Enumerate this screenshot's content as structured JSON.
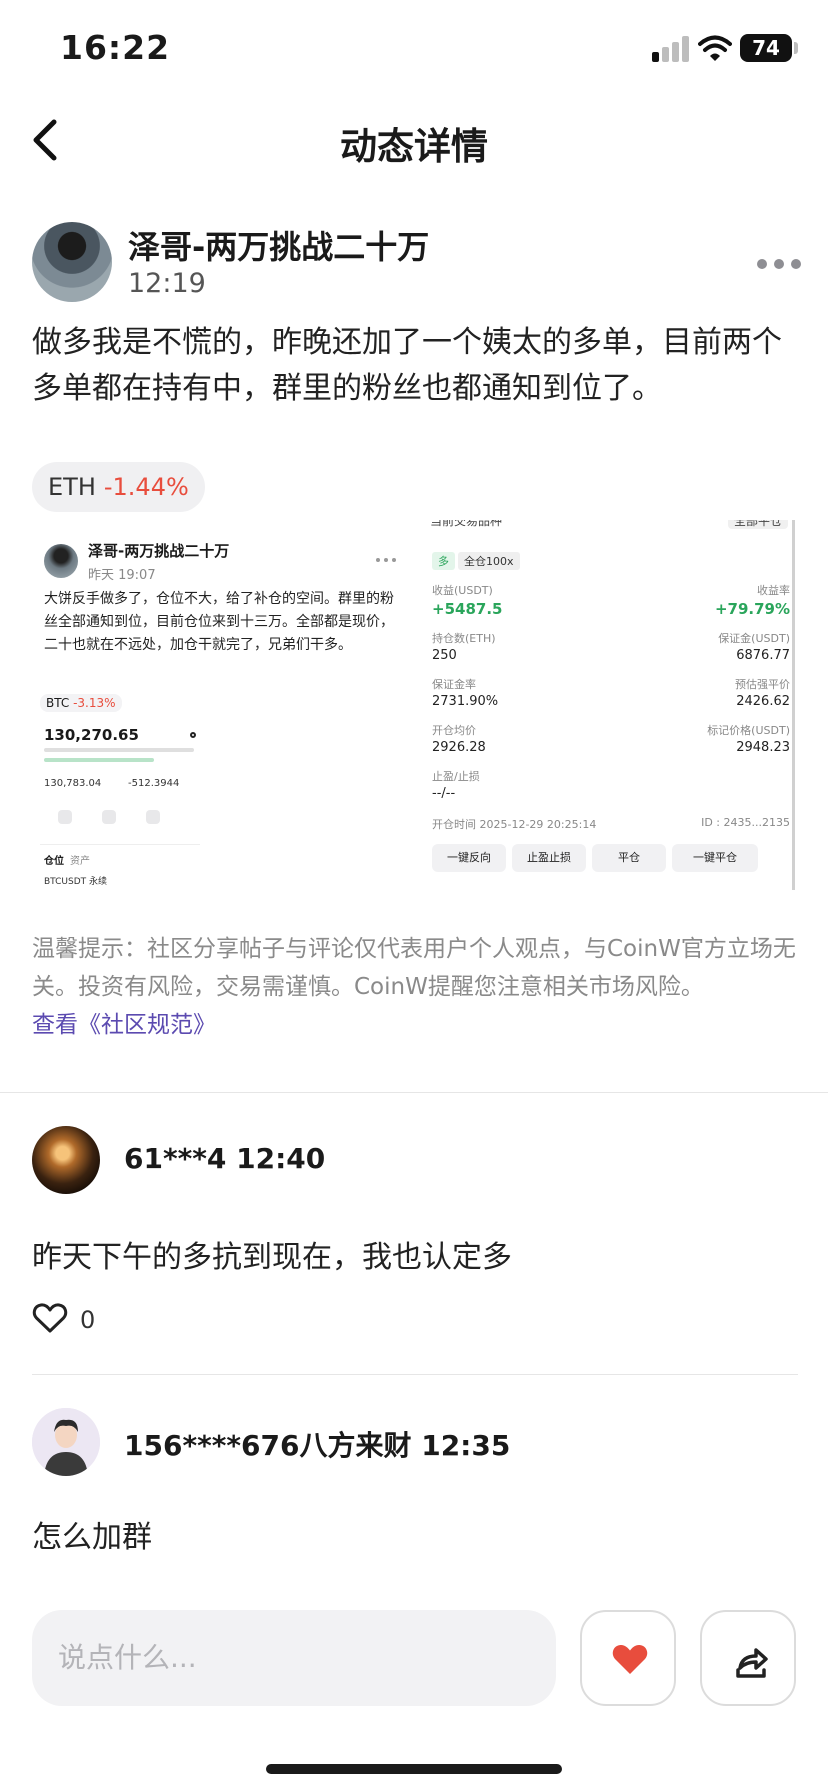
{
  "status_bar": {
    "time": "16:22",
    "battery": "74"
  },
  "nav": {
    "title": "动态详情"
  },
  "post": {
    "author": "泽哥-两万挑战二十万",
    "time": "12:19",
    "text": "做多我是不慌的，昨晚还加了一个姨太的多单，目前两个多单都在持有中，群里的粉丝也都通知到位了。",
    "ticker": {
      "symbol": "ETH",
      "change": "-1.44%"
    },
    "embedded_shot_1": {
      "author": "泽哥-两万挑战二十万",
      "time": "昨天 19:07",
      "text": "大饼反手做多了，仓位不大，给了补仓的空间。群里的粉丝全部通知到位，目前仓位来到十三万。全部都是现价，二十也就在不远处，加仓干就完了，兄弟们干多。",
      "ticker_symbol": "BTC",
      "ticker_change": "-3.13%",
      "price": "130,270.65",
      "value1": "130,783.04",
      "value2": "-512.3944",
      "tab1": "仓位",
      "tab2": "资产",
      "position": "BTCUSDT 永续"
    },
    "embedded_shot_2": {
      "header_left": "当前交易品种",
      "header_right": "全部平仓",
      "badge_dir": "多",
      "badge_lev": "全仓100x",
      "pnl_label": "收益(USDT)",
      "pnl_value": "+5487.5",
      "roe_label": "收益率",
      "roe_value": "+79.79%",
      "size_label": "持仓数(ETH)",
      "size_value": "250",
      "margin_label": "保证金(USDT)",
      "margin_value": "6876.77",
      "ratio_label": "保证金率",
      "ratio_value": "2731.90%",
      "liq_label": "预估强平价",
      "liq_value": "2426.62",
      "entry_label": "开仓均价",
      "entry_value": "2926.28",
      "mark_label": "标记价格(USDT)",
      "mark_value": "2948.23",
      "tpsl_label": "止盈/止损",
      "tpsl_value": "--/--",
      "open_time": "开仓时间 2025-12-29 20:25:14",
      "id": "ID : 2435...2135",
      "btn1": "一键反向",
      "btn2": "止盈止损",
      "btn3": "平仓",
      "btn4": "一键平仓"
    },
    "notice": "温馨提示：社区分享帖子与评论仅代表用户个人观点，与CoinW官方立场无关。投资有风险，交易需谨慎。CoinW提醒您注意相关市场风险。",
    "notice_link": "查看《社区规范》"
  },
  "comments": [
    {
      "meta": "61***4 12:40",
      "text": "昨天下午的多抗到现在，我也认定多",
      "likes": "0"
    },
    {
      "meta": "156****676八方来财 12:35",
      "text": "怎么加群"
    }
  ],
  "bottom": {
    "placeholder": "说点什么..."
  },
  "colors": {
    "accent_red": "#e84d3d",
    "gain_green": "#2aa55b",
    "link_purple": "#5b4ab0"
  }
}
